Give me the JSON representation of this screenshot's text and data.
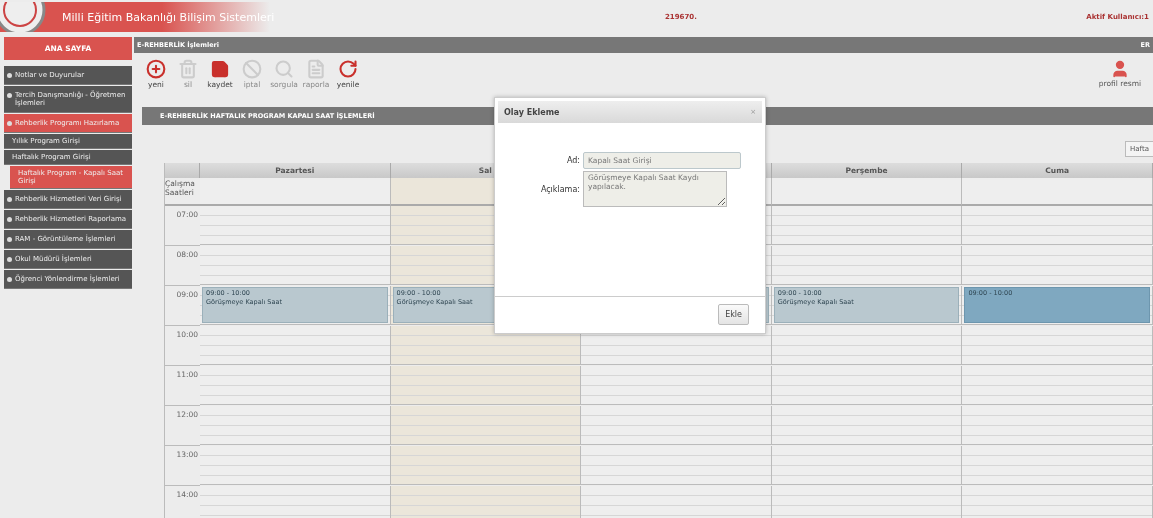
{
  "header": {
    "title": "Milli Eğitim Bakanlığı Bilişim Sistemleri",
    "code": "219670.",
    "active_users": "Aktif Kullanıcı:1"
  },
  "sidebar": {
    "home": "ANA SAYFA",
    "items": [
      {
        "label": "Notlar ve Duyurular",
        "expanded": false
      },
      {
        "label": "Tercih Danışmanlığı - Öğretmen İşlemleri",
        "expanded": false
      },
      {
        "label": "Rehberlik Programı Hazırlama",
        "expanded": true,
        "children": [
          {
            "label": "Yıllık Program Girişi",
            "selected": false
          },
          {
            "label": "Haftalık Program Girişi",
            "selected": false
          },
          {
            "label": "Haftalık Program - Kapalı Saat Girişi",
            "selected": true
          }
        ]
      },
      {
        "label": "Rehberlik Hizmetleri Veri Girişi",
        "expanded": false
      },
      {
        "label": "Rehberlik Hizmetleri Raporlama",
        "expanded": false
      },
      {
        "label": "RAM - Görüntüleme İşlemleri",
        "expanded": false
      },
      {
        "label": "Okul Müdürü İşlemleri",
        "expanded": false
      },
      {
        "label": "Öğrenci Yönlendirme İşlemleri",
        "expanded": false
      }
    ]
  },
  "module_bar": {
    "title": "E-REHBERLİK İşlemleri",
    "right": "ER"
  },
  "toolbar": [
    {
      "kind": "add",
      "label": "yeni",
      "disabled": false
    },
    {
      "kind": "delete",
      "label": "sil",
      "disabled": true
    },
    {
      "kind": "save",
      "label": "kaydet",
      "disabled": false
    },
    {
      "kind": "cancel",
      "label": "iptal",
      "disabled": true
    },
    {
      "kind": "search",
      "label": "sorgula",
      "disabled": true
    },
    {
      "kind": "report",
      "label": "raporla",
      "disabled": true
    },
    {
      "kind": "refresh",
      "label": "yenile",
      "disabled": false
    }
  ],
  "profile": {
    "label": "profil resmi"
  },
  "section_title": "E-REHBERLİK HAFTALIK PROGRAM KAPALI SAAT İŞLEMLERİ",
  "week_button": "Hafta",
  "calendar": {
    "hours_label": "Çalışma Saatleri",
    "days": [
      {
        "name": "Pazartesi",
        "today": false
      },
      {
        "name": "Sal",
        "today": true
      },
      {
        "today": false
      },
      {
        "name": "Perşembe",
        "today": false
      },
      {
        "name": "Cuma",
        "today": false
      }
    ],
    "hours": [
      {
        "label": "07:00"
      },
      {
        "label": "08:00"
      },
      {
        "label": "09:00",
        "events": [
          {
            "time": "09:00 - 10:00",
            "title": "Görüşmeye Kapalı Saat",
            "selected": false
          },
          {
            "time": "09:00 - 10:00",
            "title": "Görüşmeye Kapalı Saat",
            "selected": false
          },
          {
            "selected": false
          },
          {
            "time": "09:00 - 10:00",
            "title": "Görüşmeye Kapalı Saat",
            "selected": false
          },
          {
            "time": "09:00 - 10:00",
            "selected": true
          }
        ]
      },
      {
        "label": "10:00"
      },
      {
        "label": "11:00"
      },
      {
        "label": "12:00"
      },
      {
        "label": "13:00"
      },
      {
        "label": "14:00"
      }
    ]
  },
  "dialog": {
    "title": "Olay Ekleme",
    "close": "×",
    "name_label": "Ad:",
    "name_value": "Kapalı Saat Girişi",
    "desc_label": "Açıklama:",
    "desc_value": "Görüşmeye Kapalı Saat Kaydı yapılacak.",
    "submit": "Ekle"
  }
}
